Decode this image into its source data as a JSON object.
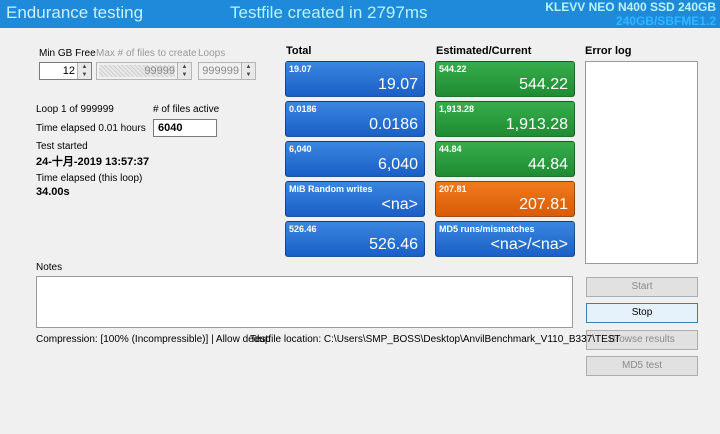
{
  "titlebar": {
    "title": "Endurance testing",
    "status": "Testfile created in 2797ms",
    "drive_line1": "KLEVV NEO N400 SSD 240GB",
    "drive_line2": "240GB/SBFME1.2"
  },
  "controls": {
    "min_gb_free_label": "Min GB Free",
    "min_gb_free_value": "12",
    "max_files_label": "Max # of files to create",
    "max_files_value": "99999",
    "loops_label": "Loops",
    "loops_value": "999999"
  },
  "status": {
    "loop": "Loop 1 of 999999",
    "files_active_label": "# of files active",
    "files_active_value": "6040",
    "time_elapsed": "Time elapsed 0.01 hours",
    "test_started_label": "Test started",
    "test_started_value": "24-十月-2019 13:57:37",
    "time_elapsed_loop_label": "Time elapsed (this loop)",
    "time_elapsed_loop_value": "34.00s"
  },
  "headers": {
    "total": "Total",
    "estimated": "Estimated/Current",
    "error_log": "Error log",
    "notes": "Notes"
  },
  "tiles_total": [
    {
      "small": "19.07",
      "big": "19.07",
      "color": "blue"
    },
    {
      "small": "0.0186",
      "big": "0.0186",
      "color": "blue"
    },
    {
      "small": "6,040",
      "big": "6,040",
      "color": "blue"
    },
    {
      "small": "MiB Random writes",
      "big": "<na>",
      "color": "blue"
    },
    {
      "small": "526.46",
      "big": "526.46",
      "color": "blue"
    }
  ],
  "tiles_estimated": [
    {
      "small": "544.22",
      "big": "544.22",
      "color": "green"
    },
    {
      "small": "1,913.28",
      "big": "1,913.28",
      "color": "green"
    },
    {
      "small": "44.84",
      "big": "44.84",
      "color": "green"
    },
    {
      "small": "207.81",
      "big": "207.81",
      "color": "orange"
    },
    {
      "small": "MD5 runs/mismatches",
      "big": "<na>/<na>",
      "color": "blue"
    }
  ],
  "buttons": {
    "start": "Start",
    "stop": "Stop",
    "browse": "Browse results",
    "md5": "MD5 test"
  },
  "footer": {
    "compression": "Compression: [100% (Incompressible)] | Allow dedup",
    "testfile": "Testfile location: C:\\Users\\SMP_BOSS\\Desktop\\AnvilBenchmark_V110_B337\\TEST"
  },
  "colors": {
    "titlebar": "#1f8ad9",
    "tile_blue": "#1a5fc6",
    "tile_green": "#1f8c33",
    "tile_orange": "#d95c06"
  }
}
